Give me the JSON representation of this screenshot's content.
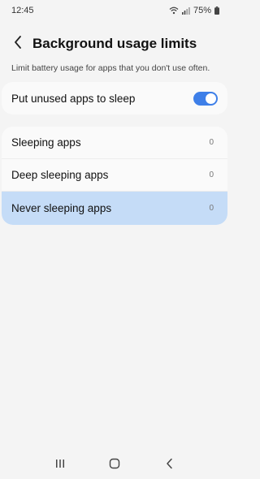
{
  "status_bar": {
    "time": "12:45",
    "battery_percent": "75%",
    "icons": [
      "wifi-icon",
      "signal-icon",
      "battery-icon"
    ]
  },
  "header": {
    "title": "Background usage limits",
    "back_icon": "back-arrow-icon"
  },
  "description": "Limit battery usage for apps that you don't use often.",
  "toggle": {
    "label": "Put unused apps to sleep",
    "on": true
  },
  "list": {
    "items": [
      {
        "label": "Sleeping apps",
        "count": "0"
      },
      {
        "label": "Deep sleeping apps",
        "count": "0"
      },
      {
        "label": "Never sleeping apps",
        "count": "0",
        "selected": true
      }
    ]
  },
  "nav_bar": {
    "icons": [
      "recents-icon",
      "home-icon",
      "back-icon"
    ]
  },
  "colors": {
    "accent": "#3e7fe8",
    "selected_row": "#c5dcf7",
    "background": "#f4f4f4"
  }
}
